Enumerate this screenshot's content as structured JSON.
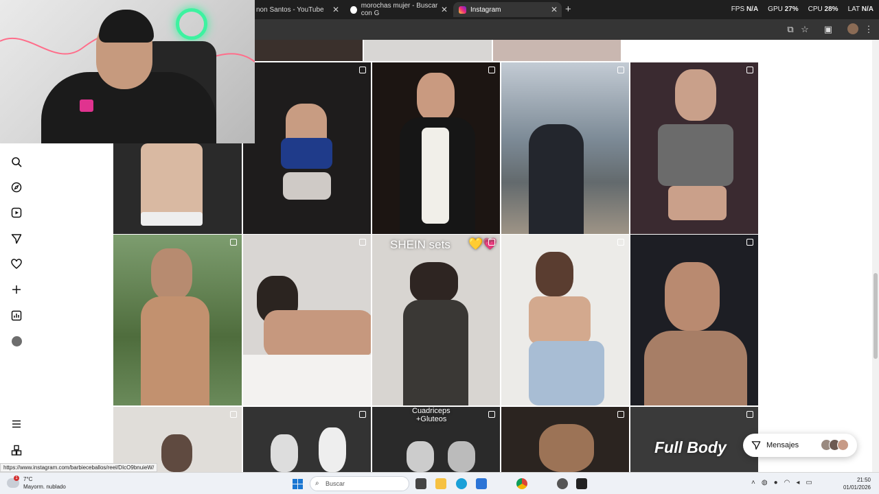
{
  "browser": {
    "tabs": [
      {
        "label": "non Santos - YouTube"
      },
      {
        "label": "morochas mujer - Buscar con G"
      },
      {
        "label": "Instagram"
      }
    ],
    "new_tab": "+",
    "perf": {
      "fps_label": "FPS",
      "fps_value": "N/A",
      "gpu_label": "GPU",
      "gpu_value": "27%",
      "cpu_label": "CPU",
      "cpu_value": "28%",
      "lat_label": "LAT",
      "lat_value": "N/A"
    }
  },
  "grid": {
    "captions": {
      "shein": "SHEIN sets",
      "cuadriceps_1": "Cuadriceps",
      "cuadriceps_2": "+Gluteos",
      "full_body": "Full Body"
    }
  },
  "messages": {
    "label": "Mensajes"
  },
  "status_url": "https://www.instagram.com/barbieceballos/reel/DIcO9bnuieW/",
  "taskbar": {
    "weather_temp": "7°C",
    "weather_desc": "Mayorm. nublado",
    "search_placeholder": "Buscar",
    "time": "21:50",
    "date": "01/01/2026"
  },
  "colors": {
    "accent_neon": "#3df2a0",
    "chrome_dark": "#1f1f1f",
    "windows_blue": "#1976d2"
  }
}
